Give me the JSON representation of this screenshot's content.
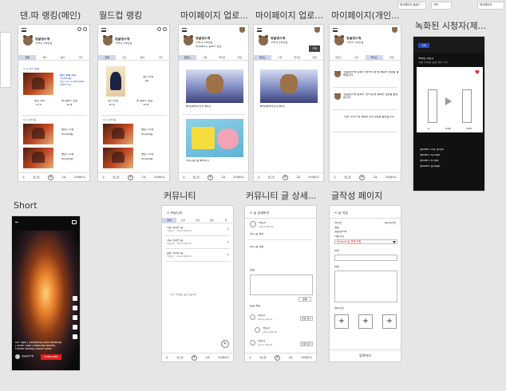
{
  "frame_titles": [
    "댄.따 랭킹(메인)",
    "월드컵 랭킹",
    "마이페이지 업로...",
    "마이페이지 업로...",
    "마이페이지(개인...",
    "녹화된 시청자(제...",
    "Short",
    "커뮤니티",
    "커뮤니티 글 상세...",
    "글작성 페이지"
  ],
  "common": {
    "channel_name": "멍글멍스쿼",
    "bottom_nav": [
      "홈",
      "월드컵",
      "+",
      "구독",
      "마이페이지"
    ],
    "plus": "+"
  },
  "frame1": {
    "profile_sub": "구독자 1.6만명",
    "tabs": [
      "전체",
      "뷰티",
      "음식",
      "기타"
    ],
    "section1_label": "인기 댄스 랭킹",
    "card1_lines": [
      "댄스 조회 1위",
      "10,000원",
      "최근 2주 1,000,000",
      "Zero 1위"
    ],
    "stat1": [
      "좋은 강의",
      "87%"
    ],
    "stat2": [
      "총 업로드 영상",
      "10개"
    ],
    "section2_label": "인기 월드컵",
    "rows": [
      [
        "랭킹: 22위",
        "¥5,000원"
      ],
      [
        "랭킹: 22위",
        "¥5,000원"
      ]
    ]
  },
  "frame2": {
    "header_sub": "구독자 1.6만명",
    "tabs": [
      "전체",
      "댄스",
      "음식",
      "기타"
    ],
    "card_lines": [
      "월간 순위",
      "1위"
    ],
    "stat1": [
      "월간 순위",
      "87%"
    ],
    "stat2": [
      "총 업로드 영상",
      "10개"
    ],
    "section_label": "인기 월드컵",
    "rows": [
      [
        "랭킹: 22위",
        "¥5,000원"
      ],
      [
        "랭킹: 22위",
        "¥5,000원"
      ]
    ]
  },
  "frame3": {
    "profile_sub": "구독자 1.6만명",
    "profile_sub2": "마이페이지 업로드 영상",
    "tabs": [
      "업로드",
      "구독",
      "좋아요",
      "댓글"
    ],
    "video1_caption": "빠뀌(빠뀌하면서 빠뀌)",
    "video2_caption": "스폰지밥 짤 빠뀌하기"
  },
  "frame4": {
    "profile_sub": "구독자 1.6만명",
    "subscribe_btn": "구독",
    "tabs": [
      "업로드",
      "구독",
      "좋아요",
      "댓글"
    ],
    "video_caption": "빠뀌(빠뀌하면서 빠뀌)"
  },
  "frame5": {
    "profile_sub": "구독자 1.6만명",
    "tabs": [
      "업로드",
      "구독",
      "좋아요",
      "댓글"
    ],
    "notices": [
      "'멍글멍스쿼'님께서 '음악의 꿈'에 새로운 영상을 올렸습니다.",
      "'멍글멍스쿼'님께서 '댄스업'에 새로운 영상을 올렸습니다.",
      "'이용 가이드'에 새로운 공지사항을 올렸습니다."
    ]
  },
  "frame6": {
    "badge": "구독",
    "top_text": "녹화된 시청자",
    "sub_text": "다음 리액션 영상 하러 가기",
    "counts": [
      "0",
      "0:00",
      "0:00"
    ],
    "comments": [
      "@user1 너무 좋아요",
      "@user2 최고예요",
      "@user3 또 봐요",
      "@user4 짱이에요"
    ]
  },
  "frame7": {
    "caption_lines": [
      "DIY Tape | Satisfying Loud Relaxing",
      "| ASMR Tape Unboxing Sounds",
      "Filmed Fantasy ASMR Video"
    ],
    "channel": "멍글멍스쿼",
    "subscribe": "SUBSCRIBE"
  },
  "frame8": {
    "header": "< 커뮤니티",
    "tabs": [
      "전체",
      "공지",
      "자유",
      "질문",
      "팁"
    ],
    "posts": [
      [
        "자유 게시판 글",
        "작성자 · 2023.06.01"
      ],
      [
        "자유 게시판 글",
        "작성자 · 2023.06.01"
      ],
      [
        "질문 게시판 글",
        "작성자 · 2023.06.01"
      ]
    ],
    "empty_text": "아직 작성된 글이 없어요"
  },
  "frame9": {
    "header": "< 글 상세보기",
    "author": "작성자",
    "date": "2023.06.01",
    "title": "게시 글 제목",
    "body": "게시 글 내용",
    "comment_label": "댓글",
    "comment_btn": "등록",
    "reply_label": "답글 목록",
    "replies": [
      [
        "작성자",
        "2023.06.01"
      ],
      [
        "작성자",
        "2023.06.01"
      ],
      [
        "작성자",
        "2023.06.01"
      ]
    ],
    "reply_btn": "답글 달기"
  },
  "frame10": {
    "header": "< 글 작성",
    "board_label": "게시판",
    "board_value": "자유게시판",
    "channel_label": "채널",
    "channel_value": "멍글멍스쿼",
    "category_label": "카테고리",
    "category_value": "Default 글 선택 안함",
    "title_label": "제목",
    "content_label": "내용",
    "image_label": "첨부사진",
    "submit": "등록하기"
  },
  "stray_labels": [
    "마이페이지 업로드",
    "구독",
    "마이페이지"
  ]
}
